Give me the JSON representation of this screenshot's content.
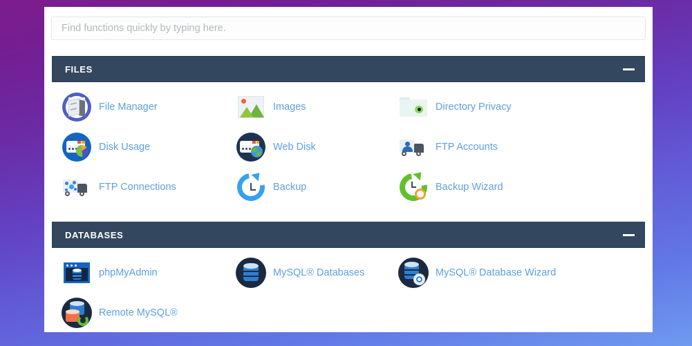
{
  "search": {
    "placeholder": "Find functions quickly by typing here.",
    "value": ""
  },
  "colors": {
    "header_bg": "#33475e",
    "link": "#5e9fe0",
    "card_bg": "#ffffff",
    "bg_gradient_start": "#7d1c8c",
    "bg_gradient_end": "#6f9aef"
  },
  "sections": [
    {
      "title": "FILES",
      "collapse_label": "−",
      "items": [
        {
          "label": "File Manager",
          "icon": "file-manager-icon"
        },
        {
          "label": "Images",
          "icon": "images-icon"
        },
        {
          "label": "Directory Privacy",
          "icon": "directory-privacy-icon"
        },
        {
          "label": "Disk Usage",
          "icon": "disk-usage-icon"
        },
        {
          "label": "Web Disk",
          "icon": "web-disk-icon"
        },
        {
          "label": "FTP Accounts",
          "icon": "ftp-accounts-icon"
        },
        {
          "label": "FTP Connections",
          "icon": "ftp-connections-icon"
        },
        {
          "label": "Backup",
          "icon": "backup-icon"
        },
        {
          "label": "Backup Wizard",
          "icon": "backup-wizard-icon"
        }
      ]
    },
    {
      "title": "DATABASES",
      "collapse_label": "−",
      "items": [
        {
          "label": "phpMyAdmin",
          "icon": "phpmyadmin-icon"
        },
        {
          "label": "MySQL® Databases",
          "icon": "mysql-databases-icon"
        },
        {
          "label": "MySQL® Database Wizard",
          "icon": "mysql-database-wizard-icon"
        },
        {
          "label": "Remote MySQL®",
          "icon": "remote-mysql-icon"
        }
      ]
    }
  ]
}
